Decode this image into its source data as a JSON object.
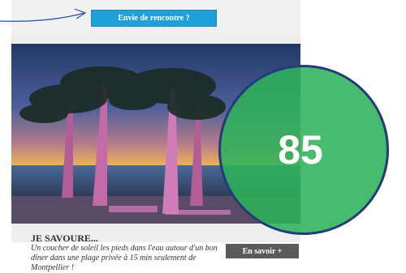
{
  "cta": {
    "label": "Envie de rencontre ?"
  },
  "card": {
    "title": "JE SAVOURE...",
    "description": "Un coucher de soleil les pieds dans l'eau autour d'un bon dîner dans une plage privée à 15 min seulement de Montpellier !",
    "button_label": "En savoir +"
  },
  "badge": {
    "score": "85",
    "color": "#2eb25a",
    "border_color": "#233b79"
  },
  "colors": {
    "cta_blue": "#1fa0d8",
    "button_gray": "#5a5a5a"
  }
}
